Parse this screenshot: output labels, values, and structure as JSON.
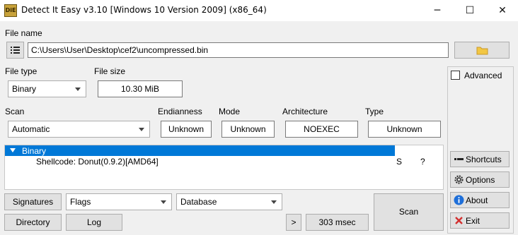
{
  "window": {
    "title": "Detect It Easy v3.10 [Windows 10 Version 2009] (x86_64)",
    "app_icon_text": "DiE",
    "minimize": "─",
    "maximize": "☐",
    "close": "✕"
  },
  "file": {
    "label": "File name",
    "path": "C:\\Users\\User\\Desktop\\cef2\\uncompressed.bin"
  },
  "file_type": {
    "label": "File type",
    "value": "Binary"
  },
  "file_size": {
    "label": "File size",
    "value": "10.30 MiB"
  },
  "scan": {
    "label": "Scan",
    "value": "Automatic"
  },
  "endianness": {
    "label": "Endianness",
    "value": "Unknown"
  },
  "mode": {
    "label": "Mode",
    "value": "Unknown"
  },
  "architecture": {
    "label": "Architecture",
    "value": "NOEXEC"
  },
  "type": {
    "label": "Type",
    "value": "Unknown"
  },
  "results": {
    "root": "Binary",
    "child": "Shellcode: Donut(0.9.2)[AMD64]",
    "col_s": "S",
    "col_q": "?"
  },
  "bottom": {
    "signatures": "Signatures",
    "flags": "Flags",
    "database": "Database",
    "directory": "Directory",
    "log": "Log",
    "more": ">",
    "time": "303 msec",
    "scan": "Scan"
  },
  "side": {
    "advanced": "Advanced",
    "shortcuts": "Shortcuts",
    "options": "Options",
    "about": "About",
    "exit": "Exit"
  },
  "colors": {
    "selection": "#0078d7",
    "about_icon": "#1e6fd9",
    "exit_icon": "#d32f2f",
    "folder_icon": "#f2c744"
  },
  "icons": {
    "list": "list-icon",
    "folder": "folder-icon",
    "shortcuts": "shortcuts-icon",
    "options": "gear-icon",
    "about": "info-icon",
    "exit": "exit-icon",
    "tree_expand": "triangle-down-icon"
  }
}
